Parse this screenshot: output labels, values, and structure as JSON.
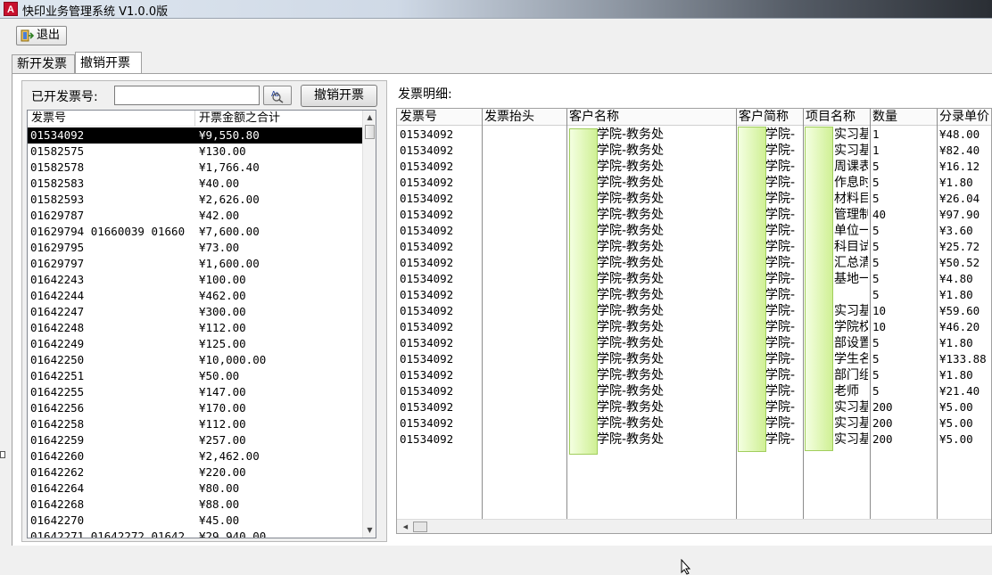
{
  "window": {
    "title": "快印业务管理系统 V1.0.0版",
    "icon_letter": "A"
  },
  "toolbar": {
    "exit_label": "退出"
  },
  "tabs": [
    {
      "label": "新开发票"
    },
    {
      "label": "撤销开票"
    }
  ],
  "left": {
    "invoice_no_label": "已开发票号:",
    "invoice_no_value": "",
    "cancel_button": "撤销开票",
    "columns": [
      "发票号",
      "开票金额之合计"
    ],
    "rows": [
      [
        "01534092",
        "¥9,550.80"
      ],
      [
        "01582575",
        "¥130.00"
      ],
      [
        "01582578",
        "¥1,766.40"
      ],
      [
        "01582583",
        "¥40.00"
      ],
      [
        "01582593",
        "¥2,626.00"
      ],
      [
        "01629787",
        "¥42.00"
      ],
      [
        "01629794 01660039 01660",
        "¥7,600.00"
      ],
      [
        "01629795",
        "¥73.00"
      ],
      [
        "01629797",
        "¥1,600.00"
      ],
      [
        "01642243",
        "¥100.00"
      ],
      [
        "01642244",
        "¥462.00"
      ],
      [
        "01642247",
        "¥300.00"
      ],
      [
        "01642248",
        "¥112.00"
      ],
      [
        "01642249",
        "¥125.00"
      ],
      [
        "01642250",
        "¥10,000.00"
      ],
      [
        "01642251",
        "¥50.00"
      ],
      [
        "01642255",
        "¥147.00"
      ],
      [
        "01642256",
        "¥170.00"
      ],
      [
        "01642258",
        "¥112.00"
      ],
      [
        "01642259",
        "¥257.00"
      ],
      [
        "01642260",
        "¥2,462.00"
      ],
      [
        "01642262",
        "¥220.00"
      ],
      [
        "01642264",
        "¥80.00"
      ],
      [
        "01642268",
        "¥88.00"
      ],
      [
        "01642270",
        "¥45.00"
      ],
      [
        "01642271 01642272 01642",
        "¥29,940.00"
      ]
    ]
  },
  "detail": {
    "label": "发票明细:",
    "columns": [
      "发票号",
      "发票抬头",
      "客户名称",
      "客户简称",
      "项目名称",
      "数量",
      "分录单价"
    ],
    "rows": [
      [
        "01534092",
        "",
        "学院-教务处",
        "学院-",
        "实习基",
        "1",
        "¥48.00"
      ],
      [
        "01534092",
        "",
        "学院-教务处",
        "学院-",
        "实习基",
        "1",
        "¥82.40"
      ],
      [
        "01534092",
        "",
        "学院-教务处",
        "学院-",
        "周课表",
        "5",
        "¥16.12"
      ],
      [
        "01534092",
        "",
        "学院-教务处",
        "学院-",
        "作息时",
        "5",
        "¥1.80"
      ],
      [
        "01534092",
        "",
        "学院-教务处",
        "学院-",
        "材料目",
        "5",
        "¥26.04"
      ],
      [
        "01534092",
        "",
        "学院-教务处",
        "学院-",
        "管理制",
        "40",
        "¥97.90"
      ],
      [
        "01534092",
        "",
        "学院-教务处",
        "学院-",
        "单位一",
        "5",
        "¥3.60"
      ],
      [
        "01534092",
        "",
        "学院-教务处",
        "学院-",
        "科目试",
        "5",
        "¥25.72"
      ],
      [
        "01534092",
        "",
        "学院-教务处",
        "学院-",
        "汇总清",
        "5",
        "¥50.52"
      ],
      [
        "01534092",
        "",
        "学院-教务处",
        "学院-",
        "基地一",
        "5",
        "¥4.80"
      ],
      [
        "01534092",
        "",
        "学院-教务处",
        "学院-",
        "",
        "5",
        "¥1.80"
      ],
      [
        "01534092",
        "",
        "学院-教务处",
        "学院-",
        "实习基",
        "10",
        "¥59.60"
      ],
      [
        "01534092",
        "",
        "学院-教务处",
        "学院-",
        "学院校",
        "10",
        "¥46.20"
      ],
      [
        "01534092",
        "",
        "学院-教务处",
        "学院-",
        "部设置",
        "5",
        "¥1.80"
      ],
      [
        "01534092",
        "",
        "学院-教务处",
        "学院-",
        "学生名",
        "5",
        "¥133.88"
      ],
      [
        "01534092",
        "",
        "学院-教务处",
        "学院-",
        "部门组",
        "5",
        "¥1.80"
      ],
      [
        "01534092",
        "",
        "学院-教务处",
        "学院-",
        "老师",
        "5",
        "¥21.40"
      ],
      [
        "01534092",
        "",
        "学院-教务处",
        "学院-",
        "实习基",
        "200",
        "¥5.00"
      ],
      [
        "01534092",
        "",
        "学院-教务处",
        "学院-",
        "实习基",
        "200",
        "¥5.00"
      ],
      [
        "01534092",
        "",
        "学院-教务处",
        "学院-",
        "实习基",
        "200",
        "¥5.00"
      ]
    ]
  }
}
